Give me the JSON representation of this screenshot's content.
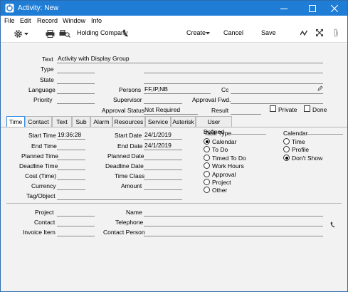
{
  "window": {
    "title": "Activity: New",
    "accent": "#1f7dd6"
  },
  "menu": [
    "File",
    "Edit",
    "Record",
    "Window",
    "Info"
  ],
  "toolbar": {
    "company": "Holding Company",
    "create": "Create",
    "cancel": "Cancel",
    "save": "Save",
    "icons": [
      "gear-icon",
      "printer-icon",
      "print-preview-icon",
      "phone-icon",
      "activity-icon",
      "expand-icon",
      "attachment-icon"
    ]
  },
  "header": {
    "text_label": "Text",
    "text_value": "Activity with Display Group",
    "type_label": "Type",
    "state_label": "State",
    "language_label": "Language",
    "priority_label": "Priority",
    "persons_label": "Persons",
    "persons_value": "FF,IP,NB",
    "cc_label": "Cc",
    "supervisor_label": "Supervisor",
    "approval_fwd_label": "Approval Fwd.",
    "approval_status_label": "Approval Status",
    "approval_status_value": "Not Required",
    "result_label": "Result",
    "private_label": "Private",
    "done_label": "Done"
  },
  "tabs": [
    "Time",
    "Contact",
    "Text",
    "Sub",
    "Alarm",
    "Resources",
    "Service",
    "Asterisk",
    "User Defined"
  ],
  "active_tab": "Time",
  "time": {
    "start_time_label": "Start Time",
    "start_time_value": "19:36:28",
    "end_time_label": "End Time",
    "planned_time_label": "Planned Time",
    "deadline_time_label": "Deadline Time",
    "cost_time_label": "Cost (Time)",
    "currency_label": "Currency",
    "tag_label": "Tag/Object",
    "start_date_label": "Start Date",
    "start_date_value": "24/1/2019",
    "end_date_label": "End Date",
    "end_date_value": "24/1/2019",
    "planned_date_label": "Planned Date",
    "deadline_date_label": "Deadline Date",
    "time_class_label": "Time Class",
    "amount_label": "Amount"
  },
  "task_type": {
    "title": "Task Type",
    "options": [
      "Calendar",
      "To Do",
      "Timed To Do",
      "Work Hours",
      "Approval",
      "Project",
      "Other"
    ],
    "selected": "Calendar"
  },
  "calendar": {
    "title": "Calendar",
    "options": [
      "Time",
      "Profile",
      "Don't Show"
    ],
    "selected": "Don't Show"
  },
  "footer": {
    "project_label": "Project",
    "contact_label": "Contact",
    "invoice_item_label": "Invoice Item",
    "name_label": "Name",
    "telephone_label": "Telephone",
    "contact_person_label": "Contact Person"
  }
}
